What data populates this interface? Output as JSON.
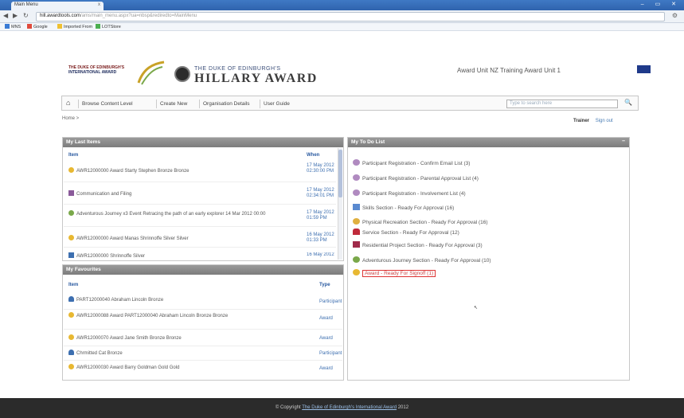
{
  "browser": {
    "tab_title": "Main Menu",
    "tab_close": "x",
    "window_controls": "– ▭ ✕",
    "url_host": "hill.awardtools.com",
    "url_rest": "/ams/main_menu.aspx?ua=nbsp&rediredto=MainMenu",
    "bookmarks": [
      {
        "label": "MNS"
      },
      {
        "label": "Google"
      },
      {
        "label": "Imported From"
      },
      {
        "label": "LOTStore"
      }
    ]
  },
  "header": {
    "logo_line1": "THE DUKE OF EDINBURGH'S",
    "logo_line2": "INTERNATIONAL AWARD",
    "brand_top": "THE DUKE OF EDINBURGH'S",
    "brand_main": "HILLARY AWARD",
    "user_info": "Award Unit NZ Training Award Unit 1"
  },
  "nav": {
    "items": [
      {
        "label": "Browse Content Level"
      },
      {
        "label": "Create New"
      },
      {
        "label": "Organisation Details"
      },
      {
        "label": "User Guide"
      }
    ],
    "search_placeholder": "Type to search here",
    "home_link": "Home >",
    "trainer_label": "Trainer",
    "signout_label": "Sign out"
  },
  "last_items": {
    "title": "My Last Items",
    "col_item": "Item",
    "col_when": "When",
    "rows": [
      {
        "text": "AWR12000000 Award Starty Stephen Bronze Bronze",
        "when": "17 May 2012 02:30:00 PM",
        "icon": "medal-icon"
      },
      {
        "text": "Communication and Filing",
        "when": "17 May 2012 02:34:01 PM",
        "icon": "document-icon"
      },
      {
        "text": "Adventurous Journey x3 Event Retracing the path of an early explorer 14 Mar 2012 00:00",
        "when": "17 May 2012 01:59 PM",
        "icon": "compass-icon"
      },
      {
        "text": "AWR12000000 Award Manas Shrinnoffe Silver Silver",
        "when": "16 May 2012 01:33 PM",
        "icon": "medal-icon"
      },
      {
        "text": "AWR12000000 Shrinnoffe Silver",
        "when": "16 May 2012",
        "icon": "person-icon"
      }
    ]
  },
  "favourites": {
    "title": "My Favourites",
    "col_item": "Item",
    "col_type": "Type",
    "rows": [
      {
        "text": "PART12000040 Abraham Lincoln Bronze",
        "type": "Participant",
        "icon": "person-icon"
      },
      {
        "text": "AWR12000088 Award PART12000040 Abraham Lincoln Bronze Bronze",
        "type": "Award",
        "icon": "medal-icon"
      },
      {
        "text": "AWR12000070 Award Jane Smith Bronze Bronze",
        "type": "Award",
        "icon": "medal-icon"
      },
      {
        "text": "Chrmitted Cat Bronze",
        "type": "Participant",
        "icon": "person-icon"
      },
      {
        "text": "AWR12000030 Award Barry Goldman Gold Gold",
        "type": "Award",
        "icon": "medal-icon"
      }
    ]
  },
  "todo": {
    "title": "My To Do List",
    "items": [
      {
        "text": "Participant Registration - Confirm Email List (3)",
        "icon": "heart-icon"
      },
      {
        "text": "Participant Registration - Parental Approval List (4)",
        "icon": "heart-icon"
      },
      {
        "text": "Participant Registration - Involvement List (4)",
        "icon": "heart-icon"
      },
      {
        "text": "Skills Section - Ready For Approval (16)",
        "icon": "skills-icon"
      },
      {
        "text": "Physical Recreation Section - Ready For Approval (16)",
        "icon": "physical-icon"
      },
      {
        "text": "Service Section - Ready For Approval (12)",
        "icon": "service-icon"
      },
      {
        "text": "Residential Project Section - Ready For Approval (3)",
        "icon": "residential-icon"
      },
      {
        "text": "Adventurous Journey Section - Ready For Approval (10)",
        "icon": "journey-icon"
      },
      {
        "text": "Award - Ready For Signoff (1)",
        "icon": "medal-icon"
      }
    ]
  },
  "footer": {
    "prefix": "© Copyright",
    "link": "The Duke of Edinburgh's International Award",
    "year": "2012"
  },
  "colors": {
    "panel_header": "#8a8a8a",
    "link": "#3d6fb0",
    "highlight": "#dd3333",
    "footer_bg": "#2b2b2b"
  }
}
